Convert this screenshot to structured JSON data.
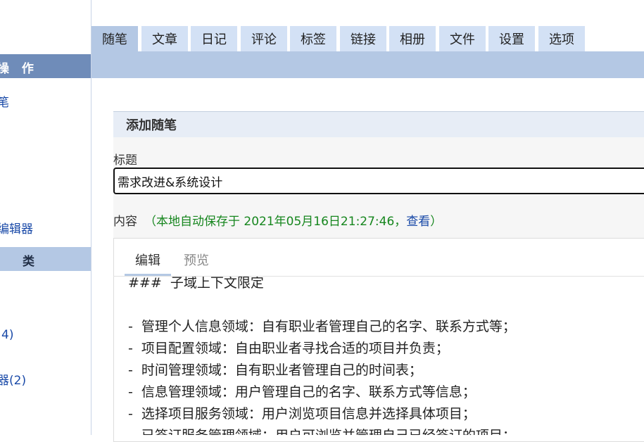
{
  "sidebar": {
    "ops_header": "操 作",
    "ops_items": [
      "笔",
      "编辑器"
    ],
    "cat_header": "类",
    "cat_items": [
      "4)",
      "器(2)"
    ]
  },
  "tabs": [
    "随笔",
    "文章",
    "日记",
    "评论",
    "标签",
    "链接",
    "相册",
    "文件",
    "设置",
    "选项"
  ],
  "active_tab": "随笔",
  "panel": {
    "title": "添加随笔",
    "title_label": "标题",
    "title_value": "需求改进&系统设计",
    "content_label": "内容",
    "autosave_text": "（本地自动保存于 2021年05月16日21:27:46，",
    "autosave_link": "查看",
    "autosave_close": "）"
  },
  "editor": {
    "tab_edit": "编辑",
    "tab_preview": "预览",
    "lines": [
      "###  子域上下文限定",
      "",
      "-  管理个人信息领域：自有职业者管理自己的名字、联系方式等；",
      "-  项目配置领域：自由职业者寻找合适的项目并负责；",
      "-  时间管理领域：自有职业者管理自己的时间表；",
      "-  信息管理领域：用户管理自己的名字、联系方式等信息；",
      "-  选择项目服务领域：用户浏览项目信息并选择具体项目；",
      "-  已签订服务管理领域：用户可浏览并管理自己已经签订的项目；"
    ]
  },
  "colors": {
    "sidebar_header": "#6f8cb9",
    "tab_bg": "#d3e1f5",
    "tab_active": "#b4c8e4",
    "autosave_green": "#16861e",
    "link_blue": "#1a4aa8"
  }
}
